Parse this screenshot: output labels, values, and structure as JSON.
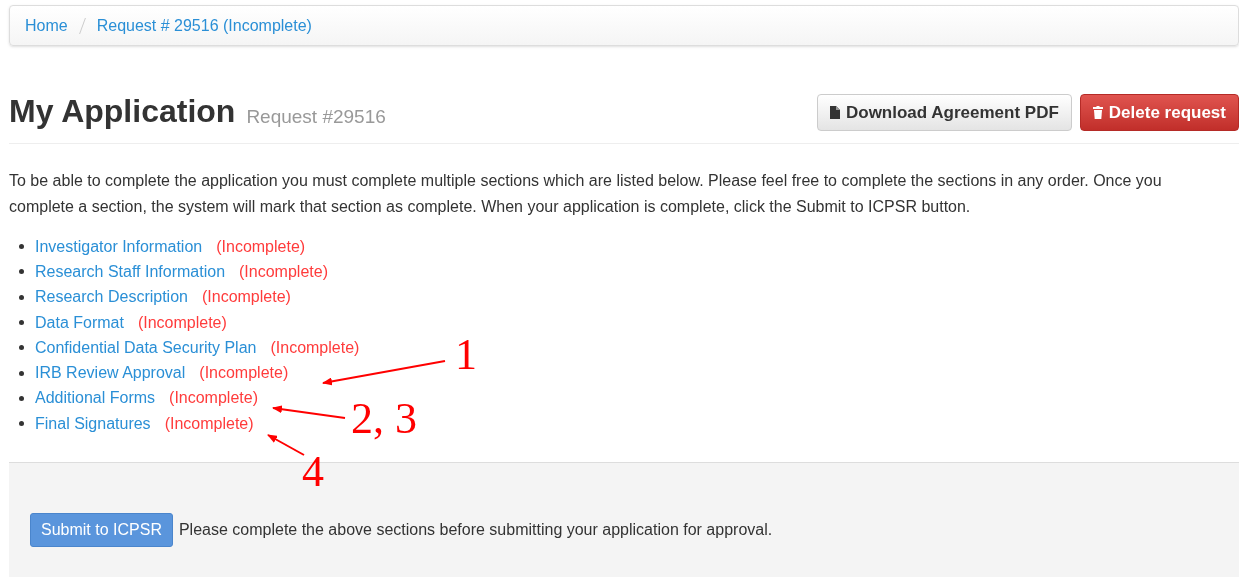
{
  "breadcrumb": [
    {
      "label": "Home"
    },
    {
      "label": "Request # 29516 (Incomplete)"
    }
  ],
  "page_header": {
    "title": "My Application",
    "subtitle": "Request #29516",
    "buttons": [
      {
        "kind": "download",
        "label": "Download Agreement PDF"
      },
      {
        "kind": "delete",
        "label": "Delete request"
      }
    ]
  },
  "intro": "To be able to complete the application you must complete multiple sections which are listed below. Please feel free to complete the sections in any order. Once you complete a section, the system will mark that section as complete. When your application is complete, click the Submit to ICPSR button.",
  "sections": [
    {
      "label": "Investigator Information",
      "status": "(Incomplete)"
    },
    {
      "label": "Research Staff Information",
      "status": "(Incomplete)"
    },
    {
      "label": "Research Description",
      "status": "(Incomplete)"
    },
    {
      "label": "Data Format",
      "status": "(Incomplete)"
    },
    {
      "label": "Confidential Data Security Plan",
      "status": "(Incomplete)"
    },
    {
      "label": "IRB Review Approval",
      "status": "(Incomplete)"
    },
    {
      "label": "Additional Forms",
      "status": "(Incomplete)"
    },
    {
      "label": "Final Signatures",
      "status": "(Incomplete)"
    }
  ],
  "footer": {
    "button": "Submit to ICPSR",
    "message": "Please complete the above sections before submitting your application for approval."
  },
  "annotations": [
    {
      "label": "1"
    },
    {
      "label": "2, 3"
    },
    {
      "label": "4"
    }
  ]
}
